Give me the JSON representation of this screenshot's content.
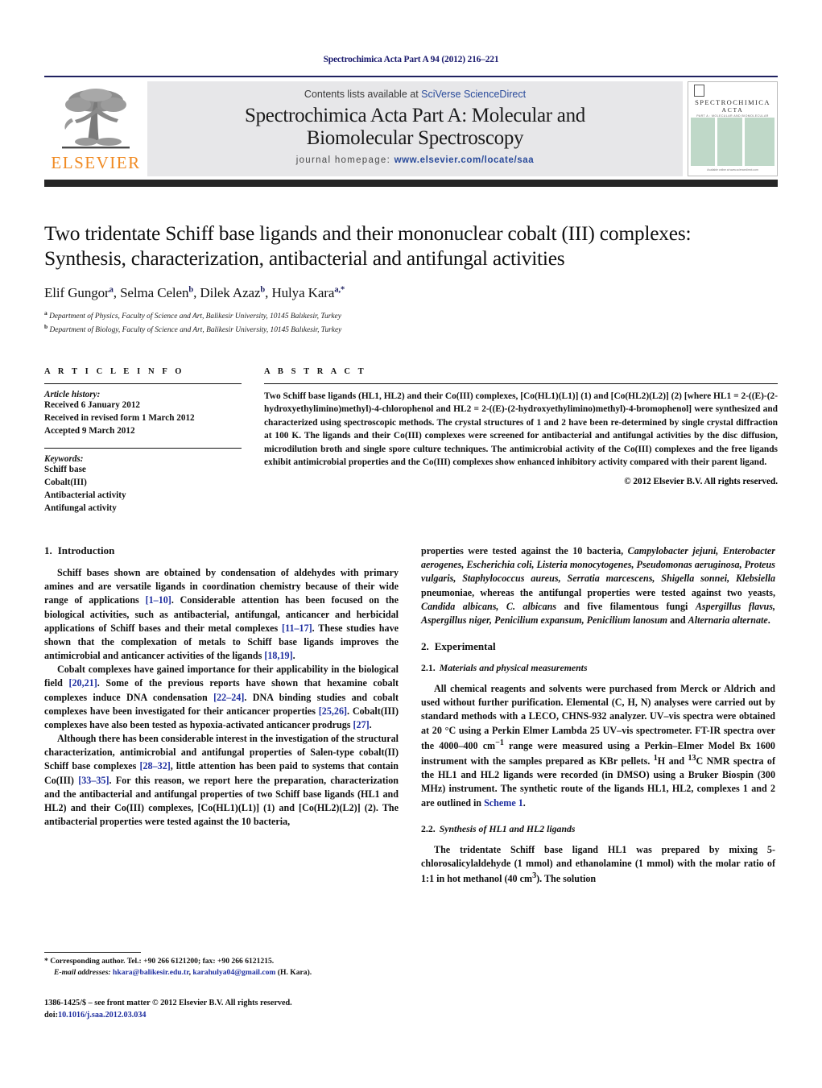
{
  "running_head": "Spectrochimica Acta Part A 94 (2012) 216–221",
  "masthead": {
    "contents_prefix": "Contents lists available at ",
    "sciencedirect_link": "SciVerse ScienceDirect",
    "journal_title_line1": "Spectrochimica Acta Part A: Molecular and",
    "journal_title_line2": "Biomolecular Spectroscopy",
    "homepage_prefix": "journal homepage:",
    "homepage_url": "www.elsevier.com/locate/saa",
    "publisher_logo_text": "ELSEVIER",
    "cover": {
      "line1": "SPECTROCHIMICA",
      "line2": "ACTA",
      "line3": "PART A : MOLECULAR AND BIOMOLECULAR SPECTROSCOPY",
      "footer": "Available online at www.sciencedirect.com"
    }
  },
  "article": {
    "title_line1": "Two tridentate Schiff base ligands and their mononuclear cobalt (III) complexes:",
    "title_line2": "Synthesis, characterization, antibacterial and antifungal activities",
    "authors": [
      {
        "name": "Elif Gungor",
        "sup": "a"
      },
      {
        "name": "Selma Celen",
        "sup": "b"
      },
      {
        "name": "Dilek Azaz",
        "sup": "b"
      },
      {
        "name": "Hulya Kara",
        "sup": "a,*"
      }
    ],
    "affiliations": [
      {
        "marker": "a",
        "text": "Department of Physics, Faculty of Science and Art, Balikesir University, 10145 Balıkesir, Turkey"
      },
      {
        "marker": "b",
        "text": "Department of Biology, Faculty of Science and Art, Balikesir University, 10145 Balıkesir, Turkey"
      }
    ]
  },
  "info": {
    "heading": "A R T I C L E    I N F O",
    "history_label": "Article history:",
    "history": [
      "Received 6 January 2012",
      "Received in revised form 1 March 2012",
      "Accepted 9 March 2012"
    ],
    "keywords_label": "Keywords:",
    "keywords": [
      "Schiff base",
      "Cobalt(III)",
      "Antibacterial activity",
      "Antifungal activity"
    ]
  },
  "abstract": {
    "heading": "A B S T R A C T",
    "text": "Two Schiff base ligands (HL1, HL2) and their Co(III) complexes, [Co(HL1)(L1)] (1) and [Co(HL2)(L2)] (2) [where HL1 = 2-((E)-(2-hydroxyethylimino)methyl)-4-chlorophenol and HL2 = 2-((E)-(2-hydroxyethylimino)methyl)-4-bromophenol] were synthesized and characterized using spectroscopic methods. The crystal structures of 1 and 2 have been re-determined by single crystal diffraction at 100 K. The ligands and their Co(III) complexes were screened for antibacterial and antifungal activities by the disc diffusion, microdilution broth and single spore culture techniques. The antimicrobial activity of the Co(III) complexes and the free ligands exhibit antimicrobial properties and the Co(III) complexes show enhanced inhibitory activity compared with their parent ligand.",
    "copyright": "© 2012 Elsevier B.V. All rights reserved."
  },
  "sections": {
    "introduction": {
      "number": "1.",
      "title": "Introduction",
      "p1_a": "Schiff bases shown are obtained by condensation of aldehydes with primary amines and are versatile ligands in coordination chemistry because of their wide range of applications ",
      "p1_ref1": "[1–10]",
      "p1_b": ". Considerable attention has been focused on the biological activities, such as antibacterial, antifungal, anticancer and herbicidal applications of Schiff bases and their metal complexes ",
      "p1_ref2": "[11–17]",
      "p1_c": ". These studies have shown that the complexation of metals to Schiff base ligands improves the antimicrobial and anticancer activities of the ligands ",
      "p1_ref3": "[18,19]",
      "p1_d": ".",
      "p2_a": "Cobalt complexes have gained importance for their applicability in the biological field ",
      "p2_ref1": "[20,21]",
      "p2_b": ". Some of the previous reports have shown that hexamine cobalt complexes induce DNA condensation ",
      "p2_ref2": "[22–24]",
      "p2_c": ". DNA binding studies and cobalt complexes have been investigated for their anticancer properties ",
      "p2_ref3": "[25,26]",
      "p2_d": ". Cobalt(III) complexes have also been tested as hypoxia-activated anticancer prodrugs ",
      "p2_ref4": "[27]",
      "p2_e": ".",
      "p3_a": "Although there has been considerable interest in the investigation of the structural characterization, antimicrobial and antifungal properties of Salen-type cobalt(II) Schiff base complexes ",
      "p3_ref1": "[28–32]",
      "p3_b": ", little attention has been paid to systems that contain Co(III) ",
      "p3_ref2": "[33–35]",
      "p3_c": ". For this reason, we report here the preparation, characterization and the antibacterial and antifungal properties of two Schiff base ligands (",
      "p3_hl1": "HL1",
      "p3_d": " and ",
      "p3_hl2": "HL2",
      "p3_e": ") and their Co(III) complexes, [Co(HL1)(L1)] (",
      "p3_n1": "1",
      "p3_f": ") and [Co(HL2)(L2)] (",
      "p3_n2": "2",
      "p3_g": "). The antibacterial properties were tested against the 10 bacteria, ",
      "p3_org1": "Campylobacter jejuni, Enterobacter aerogenes, Escherichia coli, Listeria monocytogenes, Pseudomonas aeruginosa, Proteus vulgaris, Staphylococcus aureus, Serratia marcescens, Shigella sonnei, Klebsiella",
      "p3_h": " pneumoniae, whereas the antifungal properties were tested against two yeasts, ",
      "p3_org2": "Candida albicans, C. albicans",
      "p3_i": " and five filamentous fungi ",
      "p3_org3": "Aspergillus flavus, Aspergillus niger, Penicilium expansum, Penicilium lanosum",
      "p3_j": " and ",
      "p3_org4": "Alternaria alternate",
      "p3_k": "."
    },
    "experimental": {
      "number": "2.",
      "title": "Experimental",
      "sub1": {
        "number": "2.1.",
        "title": "Materials and physical measurements"
      },
      "sub1_p_a": "All chemical reagents and solvents were purchased from Merck or Aldrich and used without further purification. Elemental (C, H, N) analyses were carried out by standard methods with a LECO, CHNS-932 analyzer. UV–vis spectra were obtained at 20 °C using a Perkin Elmer Lambda 25 UV–vis spectrometer. FT-IR spectra over the 4000–400 cm",
      "sub1_sup1": "−1",
      "sub1_p_b": " range were measured using a Perkin–Elmer Model Bx 1600 instrument with the samples prepared as KBr pellets. ",
      "sub1_sup2": "1",
      "sub1_p_c": "H and ",
      "sub1_sup3": "13",
      "sub1_p_d": "C NMR spectra of the ",
      "sub1_hl1": "HL1",
      "sub1_p_e": " and ",
      "sub1_hl2": "HL2",
      "sub1_p_f": " ligands were recorded (in DMSO) using a Bruker Biospin (300 MHz) instrument. The synthetic route of the ligands ",
      "sub1_hl1b": "HL1",
      "sub1_p_g": ", ",
      "sub1_hl2b": "HL2",
      "sub1_p_h": ", complexes ",
      "sub1_n1": "1",
      "sub1_p_i": " and ",
      "sub1_n2": "2",
      "sub1_p_j": " are outlined in ",
      "sub1_scheme": "Scheme 1",
      "sub1_p_k": ".",
      "sub2": {
        "number": "2.2.",
        "title": "Synthesis of HL1 and HL2 ligands"
      },
      "sub2_p_a": "The tridentate Schiff base ligand ",
      "sub2_hl1": "HL1",
      "sub2_p_b": " was prepared by mixing 5-chlorosalicylaldehyde (1 mmol) and ethanolamine (1 mmol) with the molar ratio of 1:1 in hot methanol (40 cm",
      "sub2_sup": "3",
      "sub2_p_c": "). The solution"
    }
  },
  "footnote": {
    "star": "*",
    "corresponding": " Corresponding author. Tel.: +90 266 6121200; fax: +90 266 6121215.",
    "email_label": "E-mail addresses:",
    "email1": "hkara@balikesir.edu.tr",
    "email_sep": ", ",
    "email2": "karahulya04@gmail.com",
    "email_person": " (H. Kara)."
  },
  "imprint": {
    "line1": "1386-1425/$ – see front matter © 2012 Elsevier B.V. All rights reserved.",
    "doi_label": "doi:",
    "doi_value": "10.1016/j.saa.2012.03.034"
  }
}
